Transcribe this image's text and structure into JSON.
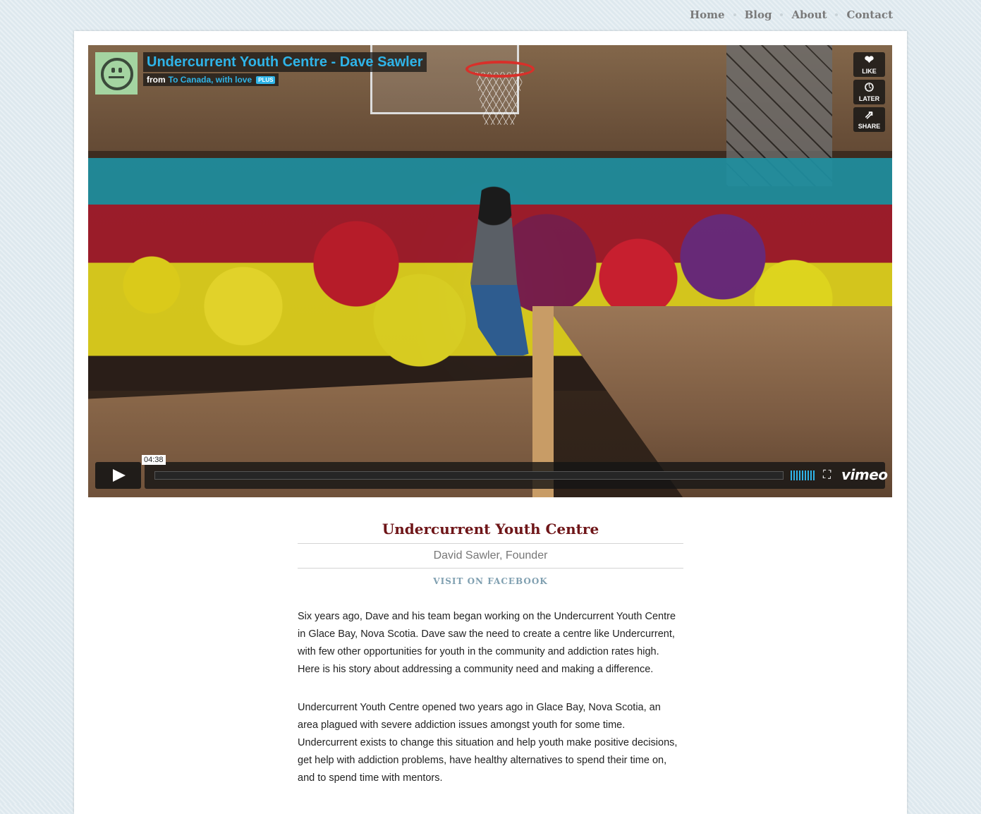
{
  "nav": {
    "items": [
      {
        "label": "Home"
      },
      {
        "label": "Blog"
      },
      {
        "label": "About"
      },
      {
        "label": "Contact"
      }
    ]
  },
  "video": {
    "title": "Undercurrent Youth Centre - Dave Sawler",
    "from_label": "from",
    "channel": "To Canada, with love",
    "plus_badge": "PLUS",
    "buttons": {
      "like": "LIKE",
      "later": "LATER",
      "share": "SHARE"
    },
    "timecode": "04:38",
    "brand": "vimeo",
    "accent_color": "#2fb4e8"
  },
  "profile": {
    "org_name": "Undercurrent Youth Centre",
    "person": "David Sawler, Founder",
    "facebook_link": "VISIT ON FACEBOOK",
    "paragraphs": [
      "Six years ago, Dave and his team began working on the Undercurrent Youth Centre in Glace Bay, Nova Scotia. Dave saw the need to create a centre like Undercurrent, with few other opportunities for youth in the community and addiction rates high. Here is his story about addressing a community need and making a difference.",
      "Undercurrent Youth Centre opened two years ago in Glace Bay, Nova Scotia, an area plagued with severe addiction issues amongst youth for some time. Undercurrent exists to change this situation and help youth make positive decisions, get help with addiction problems, have healthy alternatives to spend their time on, and to spend time with mentors."
    ],
    "title_color": "#6e1518"
  }
}
